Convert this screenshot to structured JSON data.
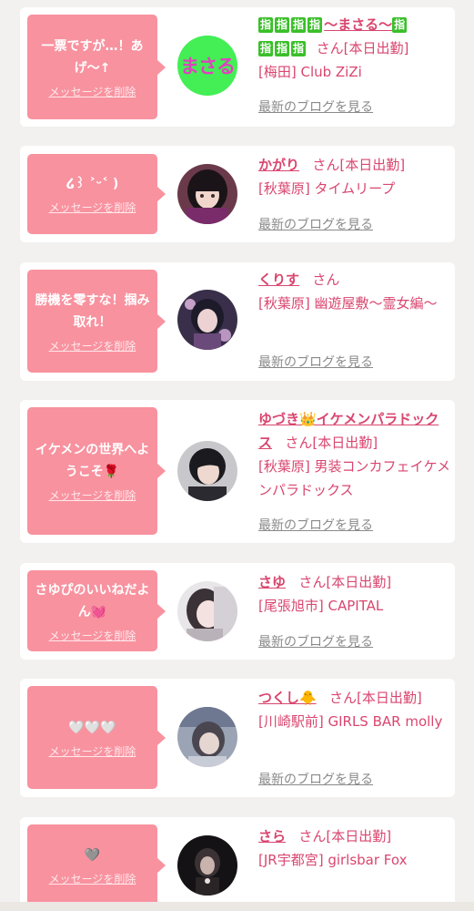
{
  "delete_label": "メッセージを削除",
  "blog_label": "最新のブログを見る",
  "san_label": "さん",
  "colors": {
    "bubble": "#f8929f",
    "accent": "#d9466f",
    "card": "#ffffff",
    "background": "#f2f1ef"
  },
  "cards": [
    {
      "message": "一票ですが…！あげ〜↑",
      "name_prefix_badges": [
        "指",
        "指",
        "指",
        "指"
      ],
      "name": "〜まさる〜",
      "name_suffix_badges": [
        "指",
        "指",
        "指",
        "指"
      ],
      "status": "[本日出勤]",
      "shop": "[梅田] Club ZiZi",
      "avatar_text": "まさる",
      "avatar_icon": "text-logo-avatar"
    },
    {
      "message": "໒꒱ ˃ᵕ˂ )",
      "name": "かがり",
      "status": "[本日出勤]",
      "shop": "[秋葉原] タイムリープ",
      "avatar_icon": "photo-avatar"
    },
    {
      "message": "勝機を零すな！掴み取れ！",
      "name": "くりす",
      "status": "",
      "shop": "[秋葉原] 幽遊屋敷〜霊女編〜",
      "avatar_icon": "photo-avatar"
    },
    {
      "message": "イケメンの世界へようこそ🌹",
      "name": "ゆづき👑イケメンパラドックス",
      "status": "[本日出勤]",
      "shop": "[秋葉原] 男装コンカフェイケメンパラドックス",
      "avatar_icon": "photo-avatar"
    },
    {
      "message": "さゆぴのいいねだよん💓",
      "name": "さゆ",
      "status": "[本日出勤]",
      "shop": "[尾張旭市] CAPITAL",
      "avatar_icon": "photo-avatar"
    },
    {
      "message": "🤍🤍🤍",
      "name": "つくし🐥",
      "status": "[本日出勤]",
      "shop": "[川崎駅前] GIRLS BAR molly",
      "avatar_icon": "photo-avatar"
    },
    {
      "message": "🩶",
      "name": "さら",
      "status": "[本日出勤]",
      "shop": "[JR宇都宮] girlsbar Fox",
      "avatar_icon": "photo-avatar"
    }
  ]
}
